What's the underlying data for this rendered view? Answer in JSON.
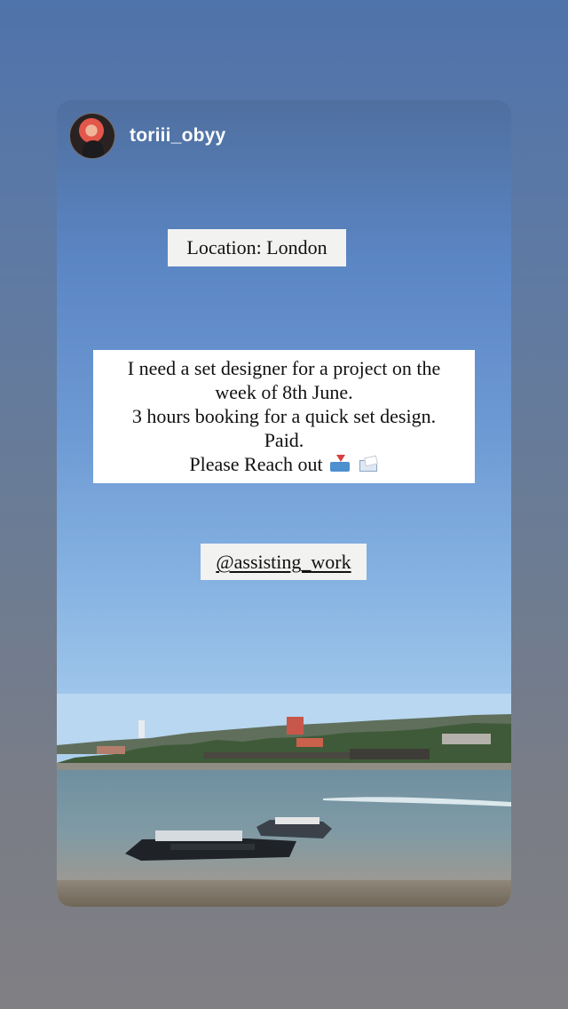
{
  "story": {
    "username": "toriii_obyy",
    "avatar_icon": "profile-photo-avatar",
    "location_text": "Location: London",
    "message_lines": [
      "I need a set designer for a project on the",
      "week of 8th June.",
      "3 hours booking for a quick set design.",
      "Paid.",
      "Please Reach out"
    ],
    "message_emojis": [
      "inbox-tray-icon",
      "envelope-icon"
    ],
    "mention": "@assisting_work"
  },
  "colors": {
    "background": "#6f7c93",
    "sticker_background": "#f2f2f1",
    "text": "#111111",
    "username": "#ffffff"
  }
}
